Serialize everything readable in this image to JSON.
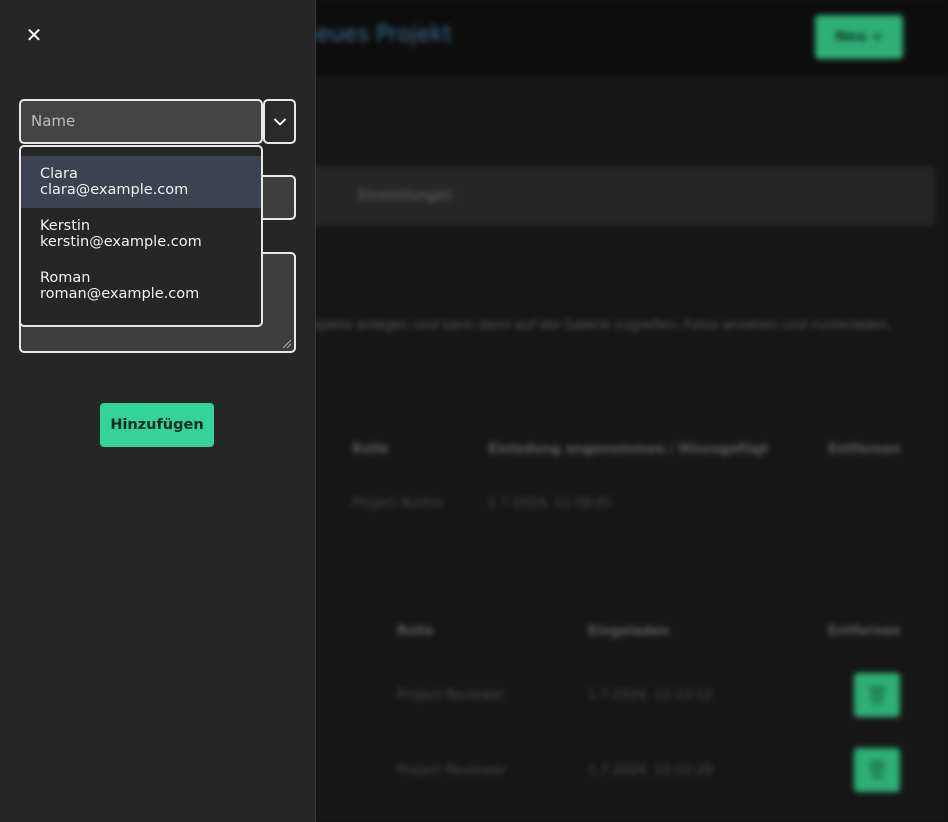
{
  "background": {
    "title": "Neues Projekt",
    "new_button": "Neu +",
    "tab": "Einstellungen",
    "description": "Projekte anlegen und kann dann auf die Galerie zugreifen, Fotos ansehen und runterladen.",
    "table1": {
      "headers": [
        "Rolle",
        "Einladung angenommen / Hinzugefügt",
        "Entfernen"
      ],
      "rows": [
        [
          "Project Author",
          "1.7.2024, 11:58:01"
        ]
      ]
    },
    "table2": {
      "headers": [
        "Rolle",
        "Eingeladen",
        "Entfernen"
      ],
      "rows": [
        [
          "Project Reviewer",
          "1.7.2024, 12:12:12"
        ],
        [
          "Project Reviewer",
          "1.7.2024, 12:12:29"
        ]
      ]
    }
  },
  "panel": {
    "close_icon": "✕",
    "name_placeholder": "Name",
    "dropdown_icon": "chevron-down-icon",
    "users": [
      {
        "name": "Clara",
        "email": "clara@example.com"
      },
      {
        "name": "Kerstin",
        "email": "kerstin@example.com"
      },
      {
        "name": "Roman",
        "email": "roman@example.com"
      }
    ],
    "add_button": "Hinzufügen"
  },
  "colors": {
    "accent": "#34d399",
    "panel_bg": "#262626",
    "active_item": "#3c4250"
  }
}
